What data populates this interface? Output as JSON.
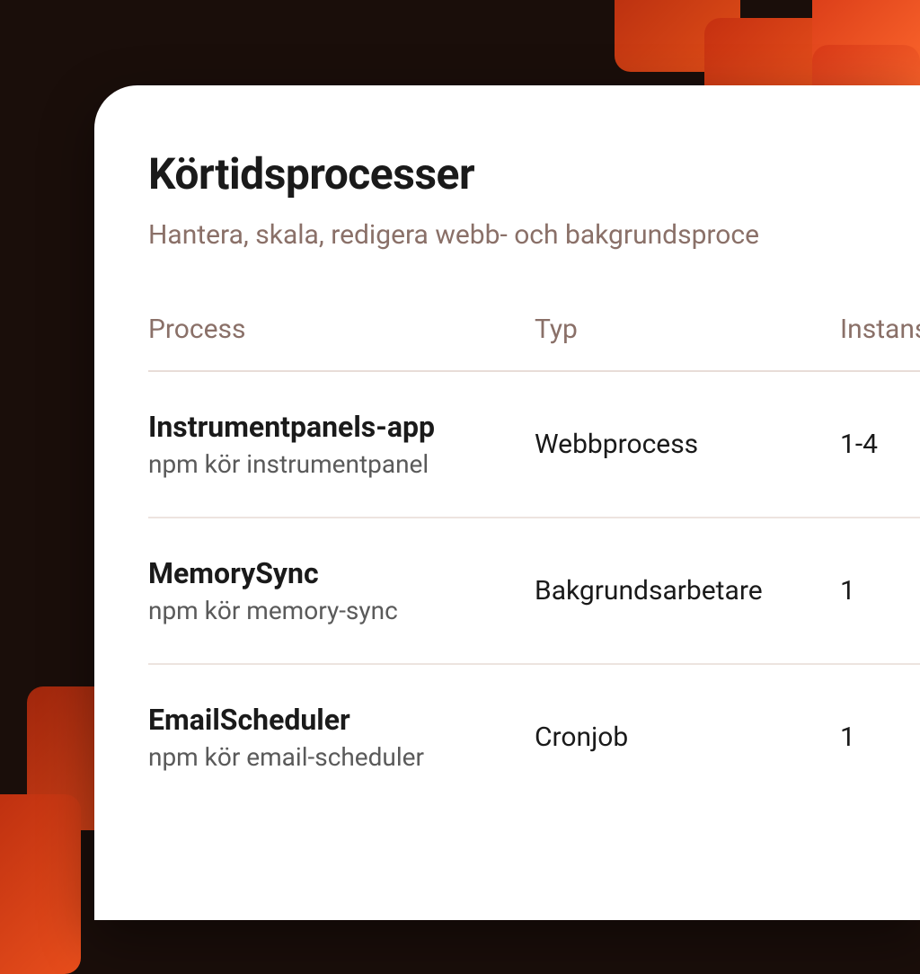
{
  "header": {
    "title": "Körtidsprocesser",
    "subtitle": "Hantera, skala, redigera webb- och bakgrundsproce"
  },
  "table": {
    "columns": {
      "process": "Process",
      "type": "Typ",
      "instances": "Instans"
    },
    "rows": [
      {
        "name": "Instrumentpanels-app",
        "cmd": "npm kör instrumentpanel",
        "type": "Webbprocess",
        "instances": "1-4"
      },
      {
        "name": "MemorySync",
        "cmd": "npm kör memory-sync",
        "type": "Bakgrundsarbetare",
        "instances": "1"
      },
      {
        "name": "EmailScheduler",
        "cmd": "npm kör email-scheduler",
        "type": "Cronjob",
        "instances": "1"
      }
    ]
  }
}
